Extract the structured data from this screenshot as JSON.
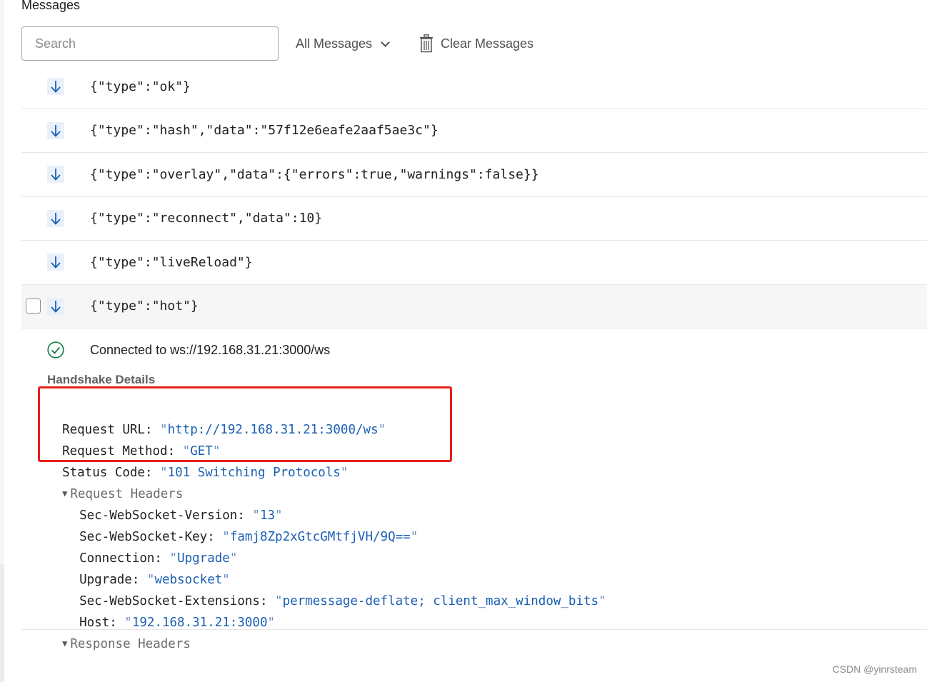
{
  "panel": {
    "title": "Messages"
  },
  "toolbar": {
    "search_placeholder": "Search",
    "filter_label": "All Messages",
    "clear_label": "Clear Messages"
  },
  "messages": [
    {
      "direction": "incoming",
      "text": "{\"type\":\"ok\"}"
    },
    {
      "direction": "incoming",
      "text": "{\"type\":\"hash\",\"data\":\"57f12e6eafe2aaf5ae3c\"}"
    },
    {
      "direction": "incoming",
      "text": "{\"type\":\"overlay\",\"data\":{\"errors\":true,\"warnings\":false}}"
    },
    {
      "direction": "incoming",
      "text": "{\"type\":\"reconnect\",\"data\":10}"
    },
    {
      "direction": "incoming",
      "text": "{\"type\":\"liveReload\"}"
    },
    {
      "direction": "incoming",
      "text": "{\"type\":\"hot\"}"
    }
  ],
  "connection": {
    "status_text": "Connected to ws://192.168.31.21:3000/ws",
    "status_color": "#107c41"
  },
  "handshake": {
    "title": "Handshake Details",
    "request_url": {
      "key": "Request URL: ",
      "value": "http://192.168.31.21:3000/ws"
    },
    "request_method": {
      "key": "Request Method: ",
      "value": "GET"
    },
    "status_code": {
      "key": "Status Code: ",
      "value": "101 Switching Protocols"
    },
    "request_headers": {
      "label": "Request Headers",
      "items": [
        {
          "key": "Sec-WebSocket-Version: ",
          "value": "13"
        },
        {
          "key": "Sec-WebSocket-Key: ",
          "value": "famj8Zp2xGtcGMtfjVH/9Q=="
        },
        {
          "key": "Connection: ",
          "value": "Upgrade"
        },
        {
          "key": "Upgrade: ",
          "value": "websocket"
        },
        {
          "key": "Sec-WebSocket-Extensions: ",
          "value": "permessage-deflate; client_max_window_bits"
        },
        {
          "key": "Host: ",
          "value": "192.168.31.21:3000"
        }
      ]
    },
    "response_headers": {
      "label": "Response Headers"
    }
  },
  "colors": {
    "accent": "#1a5fb4",
    "highlight": "#e8201b"
  },
  "watermark": "CSDN @yinrsteam"
}
